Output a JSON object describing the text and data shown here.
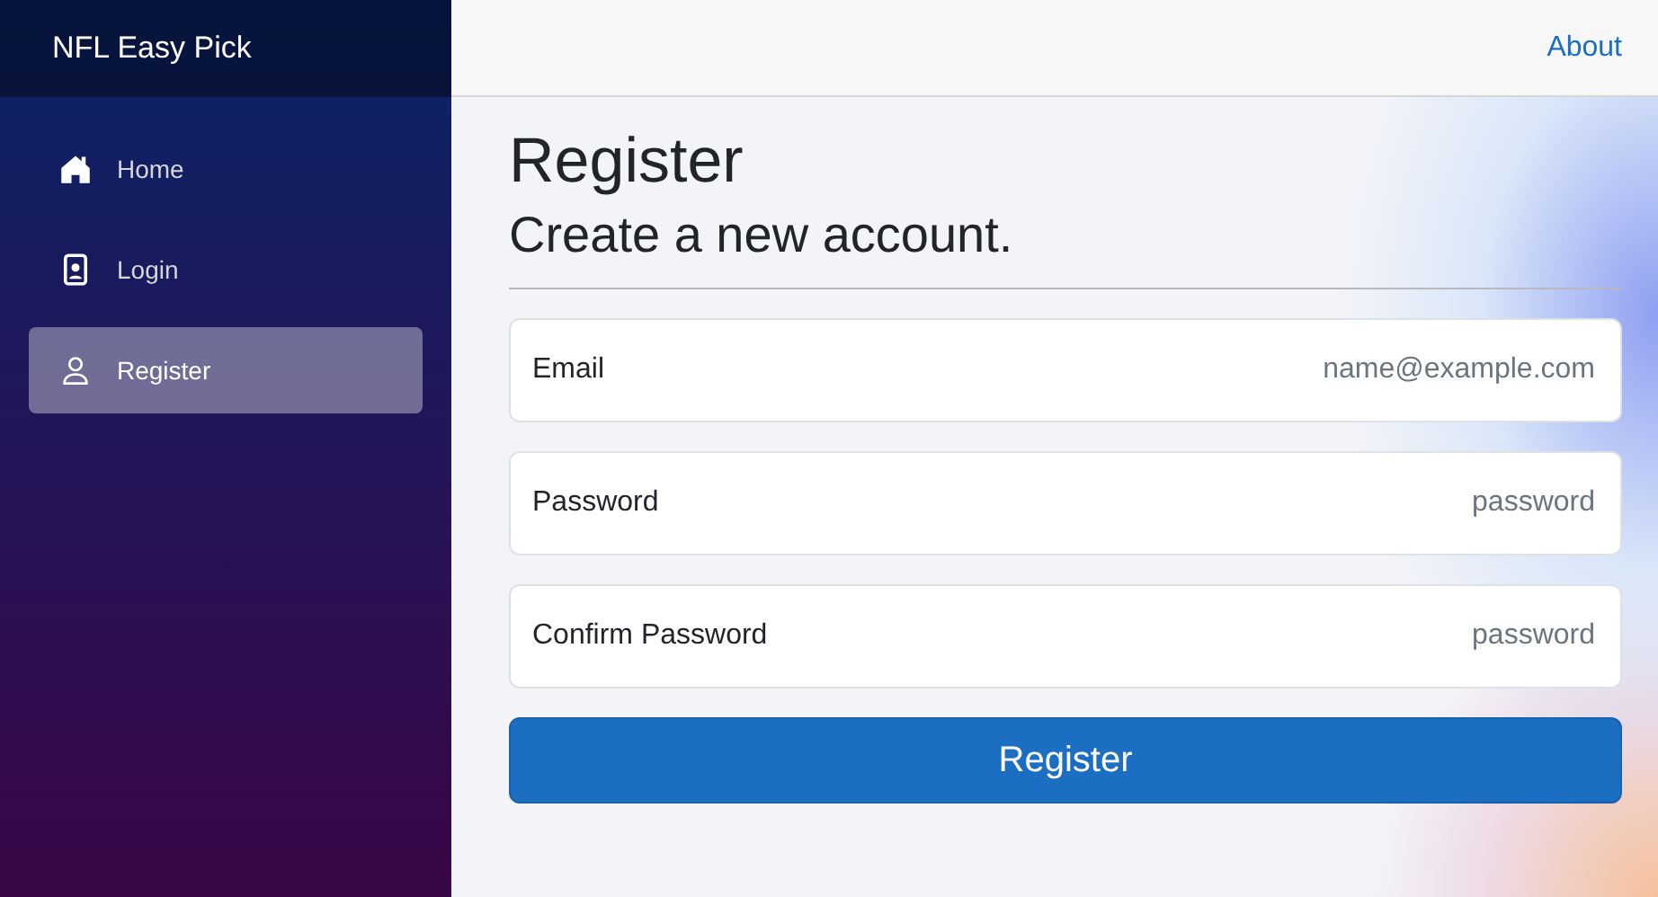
{
  "sidebar": {
    "brand": "NFL Easy Pick",
    "items": [
      {
        "label": "Home",
        "selected": false
      },
      {
        "label": "Login",
        "selected": false
      },
      {
        "label": "Register",
        "selected": true
      }
    ]
  },
  "top_bar": {
    "links": [
      "About"
    ]
  },
  "main": {
    "title": "Register",
    "subtitle": "Create a new account.",
    "fields": [
      {
        "label": "Email",
        "placeholder": "name@example.com"
      },
      {
        "label": "Password",
        "placeholder": "password"
      },
      {
        "label": "Confirm Password",
        "placeholder": "password"
      }
    ],
    "button": "Register"
  }
}
